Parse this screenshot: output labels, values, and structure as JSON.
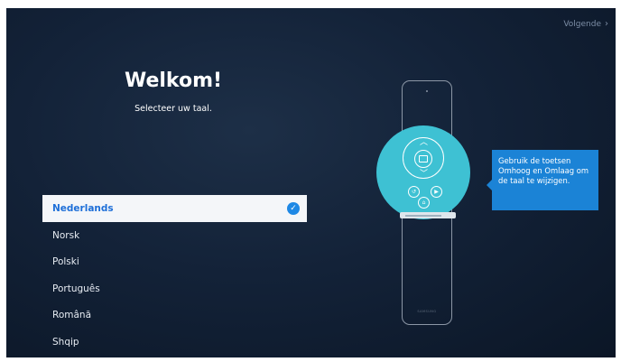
{
  "header": {
    "next_label": "Volgende",
    "next_icon": "chevron-right-icon"
  },
  "welcome": {
    "title": "Welkom!",
    "subtitle": "Selecteer uw taal."
  },
  "languages": {
    "items": [
      "Nederlands",
      "Norsk",
      "Polski",
      "Português",
      "Română",
      "Shqip"
    ],
    "selected": "Nederlands"
  },
  "tooltip": {
    "text": "Gebruik de toetsen Omhoog en Omlaag om de taal te wijzigen."
  },
  "remote": {
    "brand": "SAMSUNG"
  },
  "colors": {
    "background": "#132238",
    "accent": "#1e88e5",
    "highlight": "#3ec1d3",
    "tooltip": "#1b83d6"
  }
}
